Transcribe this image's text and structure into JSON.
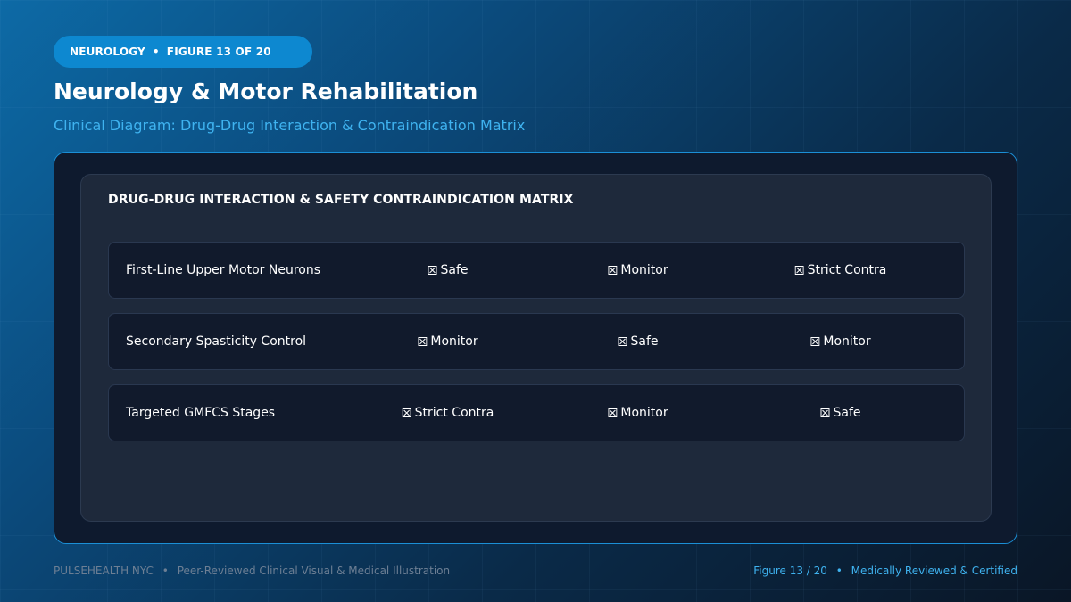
{
  "badge": {
    "category": "NEUROLOGY",
    "separator": "•",
    "figure": "FIGURE 13 OF 20"
  },
  "title": "Neurology & Motor Rehabilitation",
  "subtitle": "Clinical Diagram: Drug-Drug Interaction & Contraindication Matrix",
  "matrix": {
    "heading": "DRUG-DRUG INTERACTION & SAFETY CONTRAINDICATION MATRIX",
    "rows": [
      {
        "label": "First-Line Upper Motor Neurons",
        "cells": [
          "Safe",
          "Monitor",
          "Strict Contra"
        ]
      },
      {
        "label": "Secondary Spasticity Control",
        "cells": [
          "Monitor",
          "Safe",
          "Monitor"
        ]
      },
      {
        "label": "Targeted GMFCS Stages",
        "cells": [
          "Strict Contra",
          "Monitor",
          "Safe"
        ]
      }
    ],
    "cell_icon": "checkbox-x-icon"
  },
  "footer": {
    "brand": "PULSEHEALTH NYC",
    "separator": "•",
    "tagline": "Peer-Reviewed Clinical Visual & Medical Illustration",
    "figure": "Figure 13 / 20",
    "certification": "Medically Reviewed & Certified"
  },
  "colors": {
    "accent": "#3fb3f0",
    "badge": "#0d88d0",
    "frame_border": "#1b8fd6",
    "panel": "#1e293b",
    "row": "#111a2c"
  }
}
